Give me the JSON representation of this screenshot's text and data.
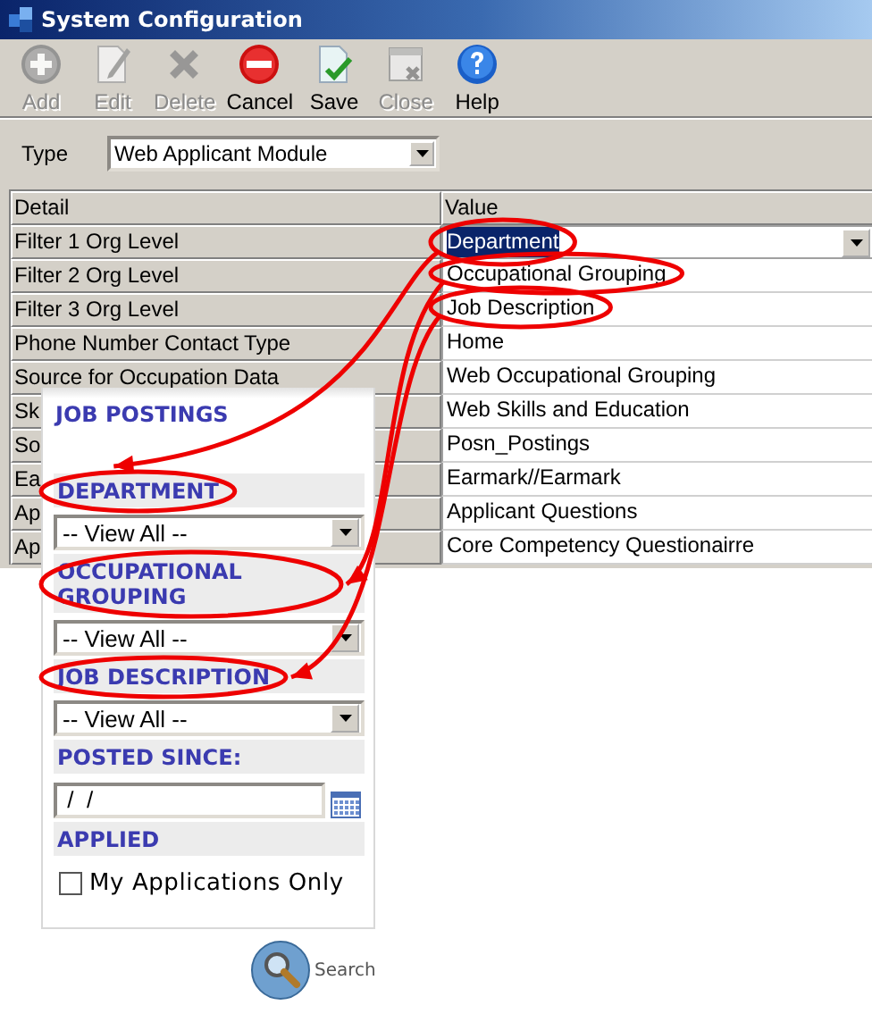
{
  "window": {
    "title": "System Configuration"
  },
  "toolbar": [
    {
      "kind": "add",
      "label": "Add",
      "disabled": true
    },
    {
      "kind": "edit",
      "label": "Edit",
      "disabled": true
    },
    {
      "kind": "delete",
      "label": "Delete",
      "disabled": true
    },
    {
      "kind": "cancel",
      "label": "Cancel",
      "disabled": false
    },
    {
      "kind": "save",
      "label": "Save",
      "disabled": false
    },
    {
      "kind": "close",
      "label": "Close",
      "disabled": true
    },
    {
      "kind": "help",
      "label": "Help",
      "disabled": false
    }
  ],
  "type_field": {
    "label": "Type",
    "value": "Web Applicant Module"
  },
  "table": {
    "columns": [
      "Detail",
      "Value"
    ],
    "rows": [
      {
        "detail": "Filter 1 Org Level",
        "value": "Department",
        "selected": true,
        "circled": true
      },
      {
        "detail": "Filter 2 Org Level",
        "value": "Occupational Grouping",
        "selected": false,
        "circled": true
      },
      {
        "detail": "Filter 3 Org Level",
        "value": "Job Description",
        "selected": false,
        "circled": true
      },
      {
        "detail": "Phone Number Contact Type",
        "value": "Home",
        "selected": false
      },
      {
        "detail": "Source for Occupation Data",
        "value": "Web Occupational Grouping",
        "selected": false
      },
      {
        "detail": "Sk",
        "value": "Web Skills and Education",
        "selected": false
      },
      {
        "detail": "So",
        "value": "Posn_Postings",
        "selected": false
      },
      {
        "detail": "Ea",
        "value": "Earmark//Earmark",
        "selected": false
      },
      {
        "detail": "Ap",
        "value": "Applicant Questions",
        "selected": false
      },
      {
        "detail": "Ap",
        "value": "Core Competency Questionairre",
        "selected": false
      }
    ]
  },
  "web_panel": {
    "title": "JOB POSTINGS",
    "sections": [
      {
        "kind": "select",
        "heading": "DEPARTMENT",
        "value": "-- View All --",
        "circled": true
      },
      {
        "kind": "select",
        "heading": "OCCUPATIONAL GROUPING",
        "value": "-- View All --",
        "circled": true
      },
      {
        "kind": "select",
        "heading": "JOB DESCRIPTION",
        "value": "-- View All --",
        "circled": true
      },
      {
        "kind": "date",
        "heading": "POSTED SINCE:",
        "value": " /  /"
      },
      {
        "kind": "checkbox",
        "heading": "APPLIED",
        "label": "My Applications Only",
        "checked": false
      }
    ],
    "search_button": "Search"
  }
}
